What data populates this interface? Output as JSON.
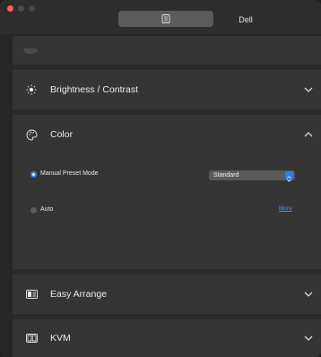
{
  "titlebar": {
    "tabs": [
      {
        "label": "",
        "icon": "document-icon",
        "active": true
      },
      {
        "label": "Dell",
        "active": false
      }
    ]
  },
  "sections": [
    {
      "label": "Brightness / Contrast",
      "icon": "sun-icon",
      "expanded": false
    },
    {
      "label": "Color",
      "icon": "palette-icon",
      "expanded": true
    },
    {
      "label": "Easy Arrange",
      "icon": "layout-icon",
      "expanded": false
    },
    {
      "label": "KVM",
      "icon": "kvm-icon",
      "expanded": false
    }
  ],
  "color": {
    "options": [
      {
        "label": "Manual Preset Mode",
        "selected": true
      },
      {
        "label": "Auto",
        "selected": false
      }
    ],
    "preset_select": {
      "value": "Standard"
    },
    "more_link": "More"
  },
  "colors": {
    "accent": "#2f7cf6",
    "close": "#ff5f57",
    "link": "#4d8ff8"
  }
}
